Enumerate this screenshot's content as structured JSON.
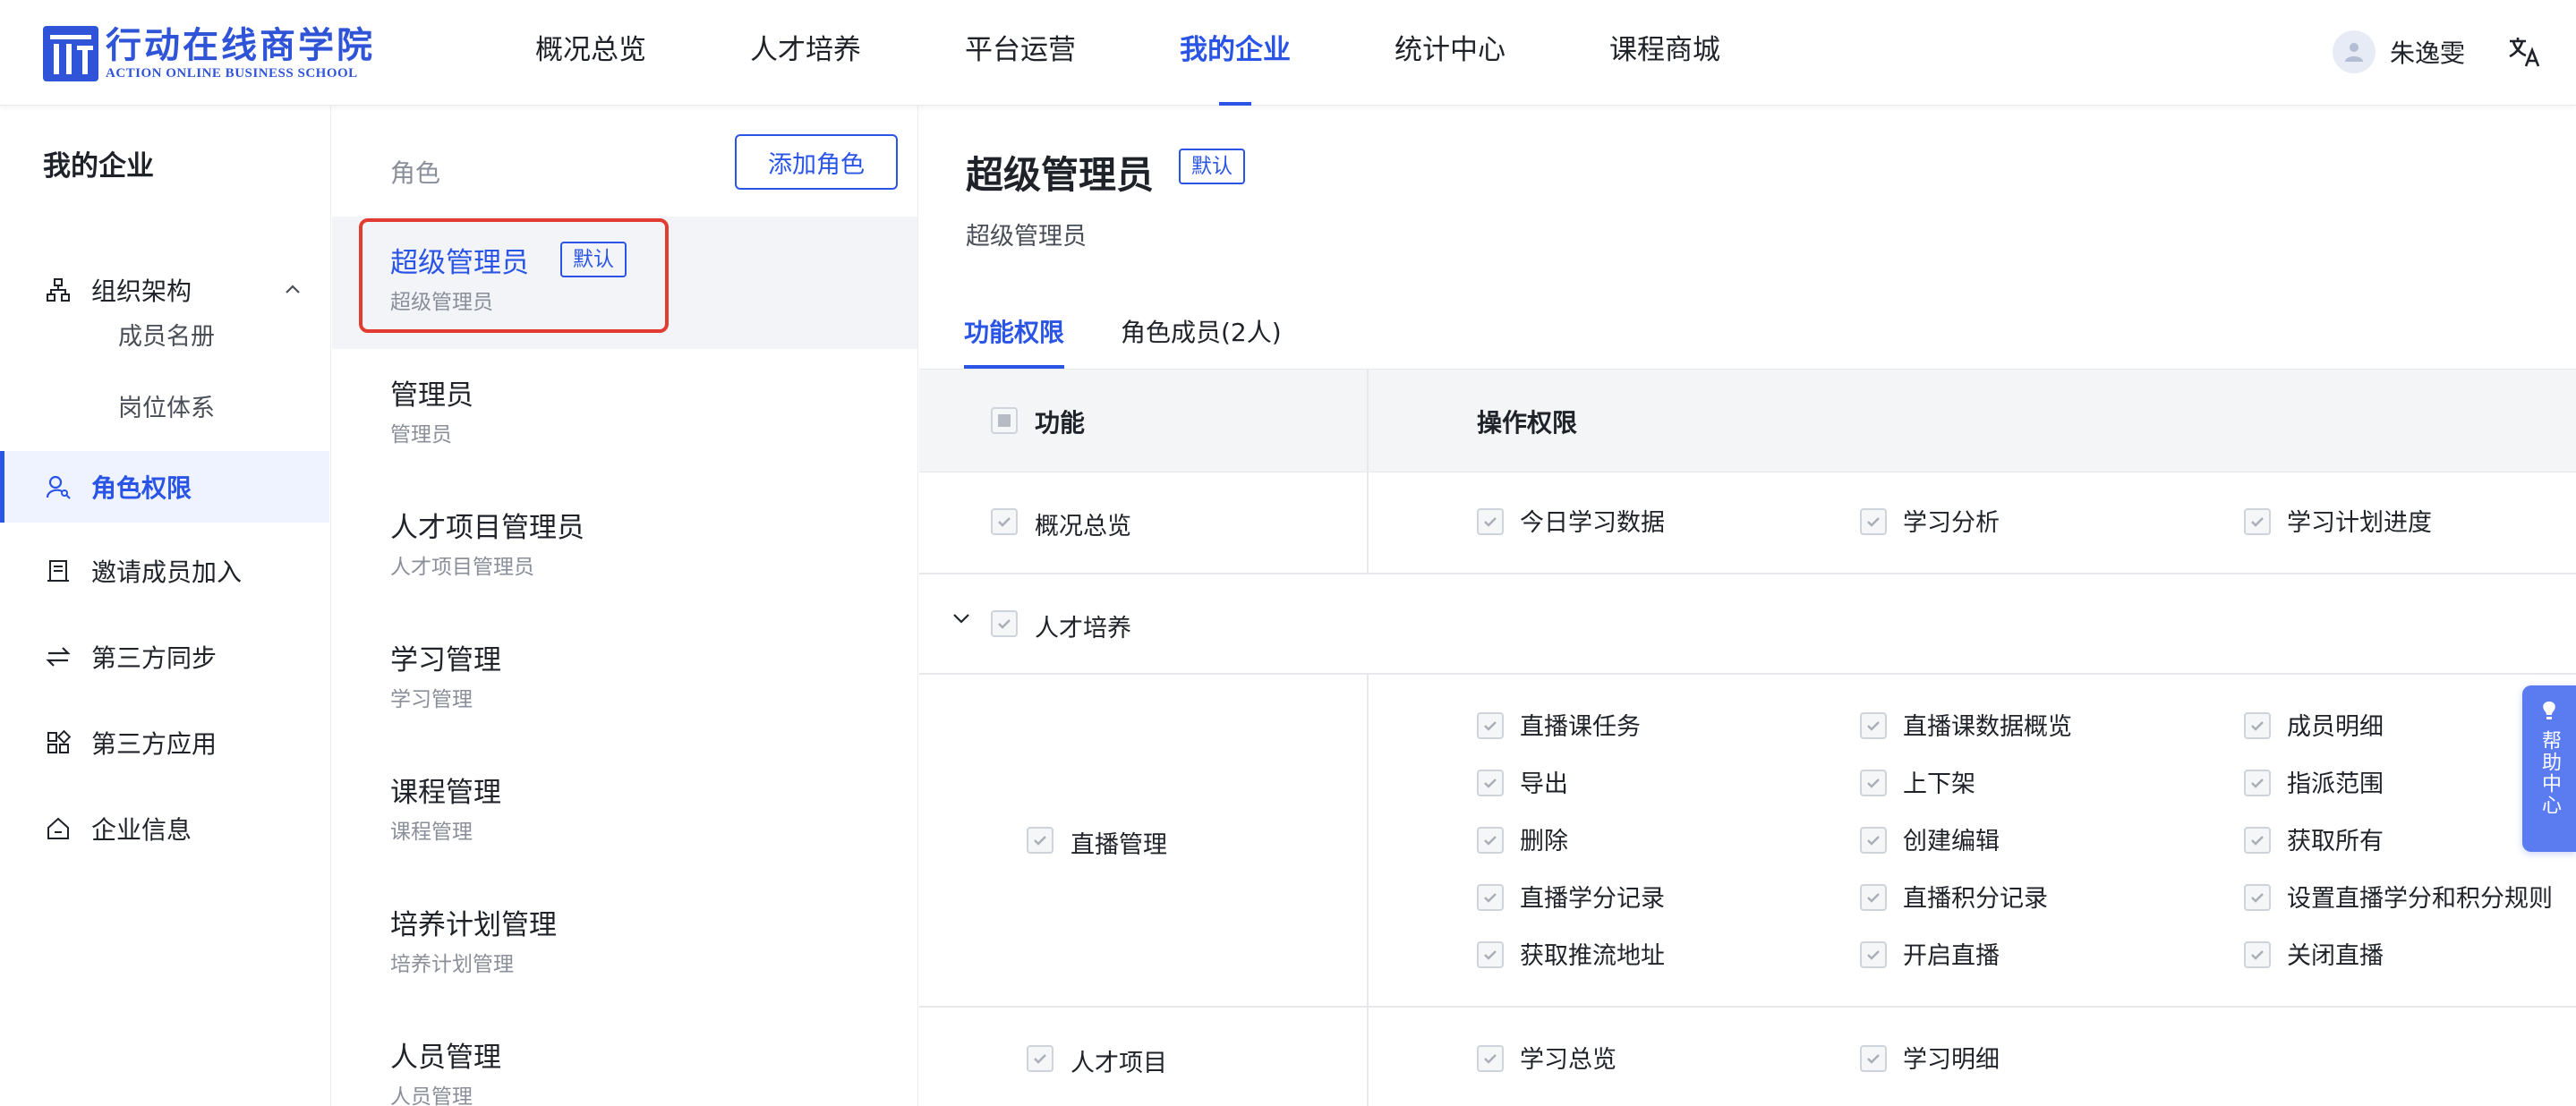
{
  "brand": {
    "name_cn": "行动在线商学院",
    "name_en": "ACTION ONLINE BUSINESS SCHOOL",
    "color": "#2f54d8"
  },
  "nav": {
    "items": [
      "概况总览",
      "人才培养",
      "平台运营",
      "我的企业",
      "统计中心",
      "课程商城"
    ],
    "active": "我的企业"
  },
  "user": {
    "name": "朱逸雯"
  },
  "sidebar": {
    "title": "我的企业",
    "org": "组织架构",
    "org_children": [
      "成员名册",
      "岗位体系"
    ],
    "roles": "角色权限",
    "invite": "邀请成员加入",
    "sync": "第三方同步",
    "apps": "第三方应用",
    "info": "企业信息"
  },
  "roles_panel": {
    "header": "角色",
    "add_button": "添加角色",
    "default_badge": "默认",
    "items": [
      {
        "name": "超级管理员",
        "desc": "超级管理员",
        "default": true,
        "selected": true
      },
      {
        "name": "管理员",
        "desc": "管理员"
      },
      {
        "name": "人才项目管理员",
        "desc": "人才项目管理员"
      },
      {
        "name": "学习管理",
        "desc": "学习管理"
      },
      {
        "name": "课程管理",
        "desc": "课程管理"
      },
      {
        "name": "培养计划管理",
        "desc": "培养计划管理"
      },
      {
        "name": "人员管理",
        "desc": "人员管理"
      }
    ]
  },
  "detail": {
    "title": "超级管理员",
    "badge": "默认",
    "subtitle": "超级管理员",
    "tabs": [
      "功能权限",
      "角色成员(2人)"
    ],
    "table": {
      "col_function": "功能",
      "col_operation": "操作权限",
      "rows": [
        {
          "function": "概况总览",
          "perms": [
            "今日学习数据",
            "学习分析",
            "学习计划进度"
          ]
        },
        {
          "function": "人才培养",
          "group": true
        },
        {
          "function": "直播管理",
          "perms": [
            "直播课任务",
            "直播课数据概览",
            "成员明细",
            "导出",
            "上下架",
            "指派范围",
            "删除",
            "创建编辑",
            "获取所有",
            "直播学分记录",
            "直播积分记录",
            "设置直播学分和积分规则",
            "获取推流地址",
            "开启直播",
            "关闭直播"
          ]
        },
        {
          "function": "人才项目",
          "perms": [
            "学习总览",
            "学习明细"
          ]
        }
      ]
    }
  },
  "help": {
    "label": "帮助中心"
  },
  "colors": {
    "accent": "#2a54e6",
    "highlight": "#e23b32"
  }
}
